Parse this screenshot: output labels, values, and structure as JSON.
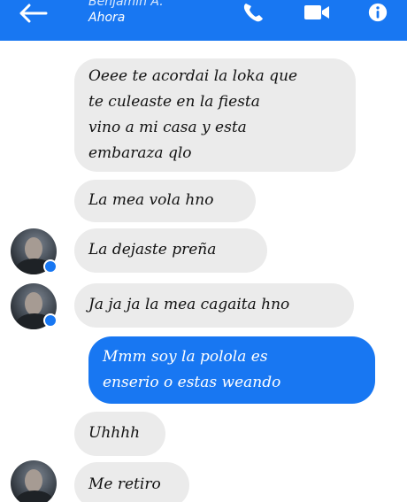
{
  "header": {
    "contact_name": "Benjamin A.",
    "status": "Ahora",
    "icons": [
      "back-arrow-icon",
      "phone-icon",
      "video-camera-icon",
      "info-icon"
    ],
    "color": "#1877f2"
  },
  "messages": [
    {
      "sender": "them",
      "lines": [
        "Oeee te acordai la loka que",
        "te culeaste en la fiesta",
        "vino a mi casa y esta",
        "embaraza qlo"
      ]
    },
    {
      "sender": "them",
      "text": "La mea vola hno"
    },
    {
      "sender": "them",
      "text": "La dejaste preña"
    },
    {
      "sender": "them",
      "text": "Ja ja ja la mea cagaita hno"
    },
    {
      "sender": "me",
      "lines": [
        "Mmm soy la polola es",
        "enserio o estas weando"
      ]
    },
    {
      "sender": "them",
      "text": "Uhhhh"
    },
    {
      "sender": "them",
      "text": "Me retiro"
    }
  ]
}
